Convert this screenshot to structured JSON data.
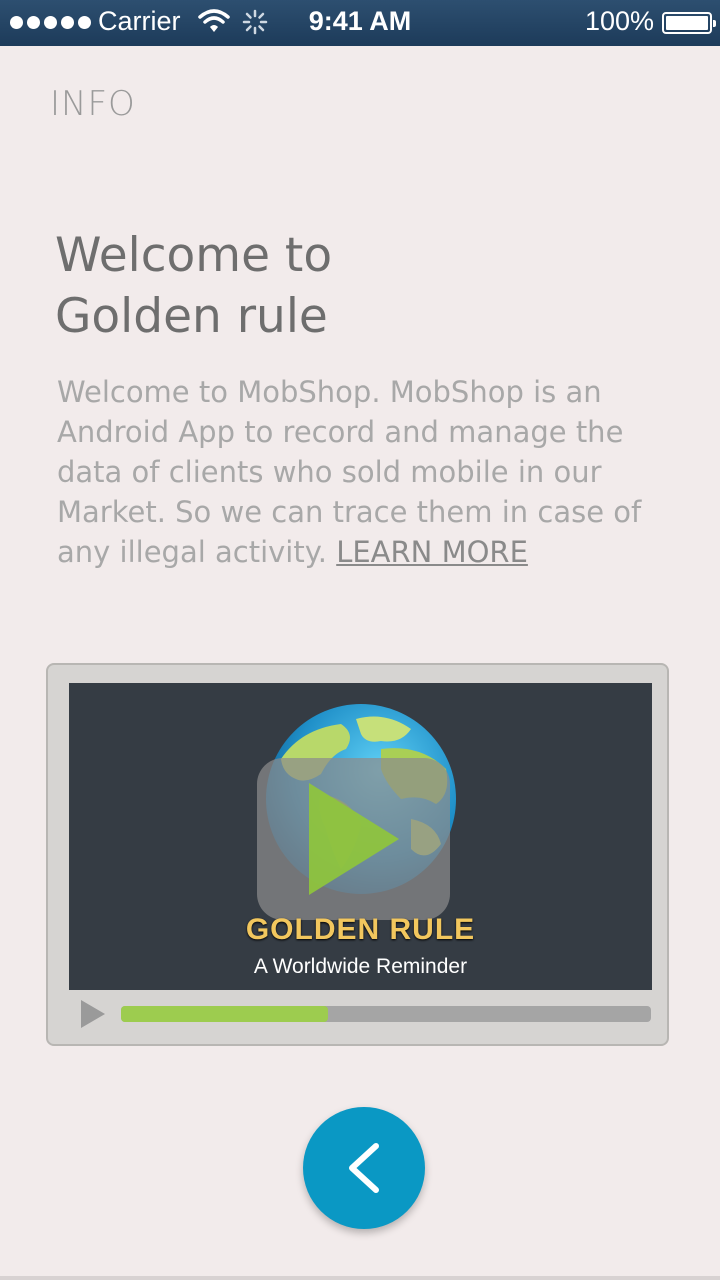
{
  "status_bar": {
    "carrier": "Carrier",
    "time": "9:41 AM",
    "battery": "100%"
  },
  "page": {
    "section_label": "INFO",
    "headline_line1": "Welcome to",
    "headline_line2": "Golden rule",
    "body": "Welcome to MobShop. MobShop is an Android App to record and manage the data of clients who sold mobile in our Market. So we can trace them in case of any illegal activity.",
    "learn_more": "LEARN MORE"
  },
  "video": {
    "title": "GOLDEN RULE",
    "subtitle": "A Worldwide Reminder",
    "progress": 0.39
  },
  "colors": {
    "accent": "#0a98c4",
    "progress": "#9dcc4f",
    "title_gold": "#f2c75e"
  },
  "icons": {
    "back": "chevron-left-icon",
    "play": "play-icon"
  }
}
